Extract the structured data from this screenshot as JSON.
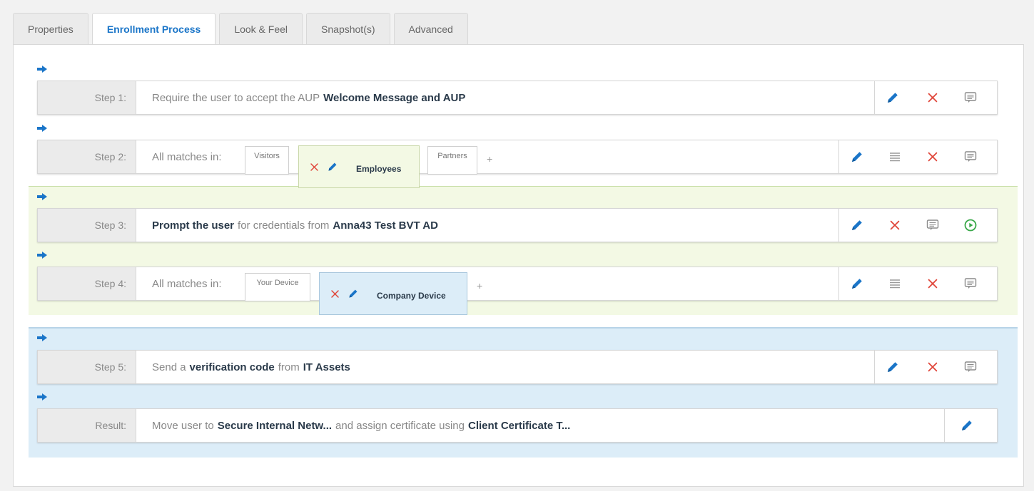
{
  "tabs": [
    "Properties",
    "Enrollment Process",
    "Look & Feel",
    "Snapshot(s)",
    "Advanced"
  ],
  "steps": [
    {
      "label": "Step 1:",
      "parts": [
        "Require the user to accept the AUP",
        "Welcome Message and AUP"
      ]
    },
    {
      "label": "Step 2:",
      "prefix": "All matches in:",
      "chips": [
        "Visitors",
        "Employees",
        "Partners"
      ],
      "plus": "+"
    },
    {
      "label": "Step 3:",
      "parts": [
        "Prompt the user",
        "for credentials from",
        "Anna43 Test BVT AD"
      ]
    },
    {
      "label": "Step 4:",
      "prefix": "All matches in:",
      "chips": [
        "Your Device",
        "Company Device"
      ],
      "plus": "+"
    },
    {
      "label": "Step 5:",
      "parts": [
        "Send a",
        "verification code",
        "from",
        "IT Assets"
      ]
    },
    {
      "label": "Result:",
      "parts": [
        "Move user to",
        "Secure Internal Netw...",
        "and assign certificate using",
        "Client Certificate T..."
      ]
    }
  ],
  "colors": {
    "accent": "#1a75c8",
    "delete": "#e0463a",
    "play": "#3aa84a",
    "zone_green": "#f3f9e4",
    "zone_blue": "#dcedf8"
  },
  "icons": {
    "step_arrow": "arrow-right-icon",
    "edit": "pencil-icon",
    "delete": "x-icon",
    "reorder": "list-icon",
    "comment": "comment-icon",
    "play": "play-circle-icon"
  }
}
